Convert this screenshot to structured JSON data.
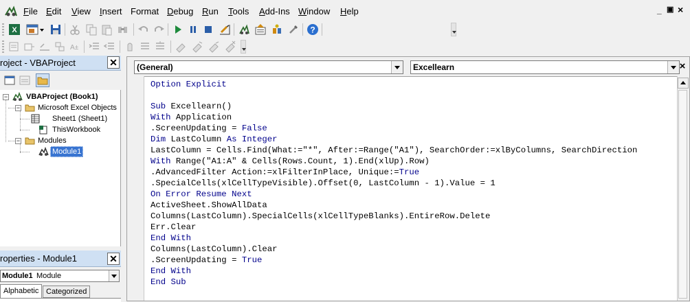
{
  "menu": {
    "items": [
      {
        "key": "F",
        "rest": "ile"
      },
      {
        "key": "E",
        "rest": "dit"
      },
      {
        "key": "V",
        "rest": "iew"
      },
      {
        "key": "I",
        "rest": "nsert"
      },
      {
        "key": "",
        "rest": "Format"
      },
      {
        "key": "D",
        "rest": "ebug"
      },
      {
        "key": "R",
        "rest": "un"
      },
      {
        "key": "T",
        "rest": "ools"
      },
      {
        "key": "A",
        "rest": "dd-Ins"
      },
      {
        "key": "W",
        "rest": "indow"
      },
      {
        "key": "H",
        "rest": "elp"
      }
    ],
    "window_controls": {
      "minimize": "_",
      "restore": "Х",
      "close": "×"
    }
  },
  "project_pane": {
    "title": "roject - VBAProject",
    "close": "✕",
    "tree": {
      "root": "VBAProject (Book1)",
      "excel_objects": "Microsoft Excel Objects",
      "sheet1": "Sheet1 (Sheet1)",
      "this_workbook": "ThisWorkbook",
      "modules": "Modules",
      "module1": "Module1",
      "collapse_sign": "−"
    }
  },
  "properties_pane": {
    "title": "roperties - Module1",
    "close": "✕",
    "object_name": "Module1",
    "object_type": "Module",
    "tabs": {
      "alphabetic": "Alphabetic",
      "categorized": "Categorized"
    }
  },
  "code_window": {
    "object_combo": "(General)",
    "procedure_combo": "Excellearn",
    "close": "×",
    "lines": [
      [
        {
          "t": "Option Explicit",
          "k": true
        }
      ],
      [],
      [
        {
          "t": "Sub ",
          "k": true
        },
        {
          "t": "Excellearn()"
        }
      ],
      [
        {
          "t": "With ",
          "k": true
        },
        {
          "t": "Application"
        }
      ],
      [
        {
          "t": ".ScreenUpdating = "
        },
        {
          "t": "False",
          "k": true
        }
      ],
      [
        {
          "t": "Dim ",
          "k": true
        },
        {
          "t": "LastColumn "
        },
        {
          "t": "As Integer",
          "k": true
        }
      ],
      [
        {
          "t": "LastColumn = Cells.Find(What:=\"*\", After:=Range(\"A1\"), SearchOrder:=xlByColumns, SearchDirection"
        }
      ],
      [
        {
          "t": "With ",
          "k": true
        },
        {
          "t": "Range(\"A1:A\" & Cells(Rows.Count, 1).End(xlUp).Row)"
        }
      ],
      [
        {
          "t": ".AdvancedFilter Action:=xlFilterInPlace, Unique:="
        },
        {
          "t": "True",
          "k": true
        }
      ],
      [
        {
          "t": ".SpecialCells(xlCellTypeVisible).Offset(0, LastColumn - 1).Value = 1"
        }
      ],
      [
        {
          "t": "On Error Resume Next",
          "k": true
        }
      ],
      [
        {
          "t": "ActiveSheet.ShowAllData"
        }
      ],
      [
        {
          "t": "Columns(LastColumn).SpecialCells(xlCellTypeBlanks).EntireRow.Delete"
        }
      ],
      [
        {
          "t": "Err.Clear"
        }
      ],
      [
        {
          "t": "End With",
          "k": true
        }
      ],
      [
        {
          "t": "Columns(LastColumn).Clear"
        }
      ],
      [
        {
          "t": ".ScreenUpdating = "
        },
        {
          "t": "True",
          "k": true
        }
      ],
      [
        {
          "t": "End With",
          "k": true
        }
      ],
      [
        {
          "t": "End Sub",
          "k": true
        }
      ]
    ]
  },
  "colors": {
    "keyword": "#00008b",
    "selection": "#3874d1",
    "pane_title": "#cfe0f3"
  }
}
